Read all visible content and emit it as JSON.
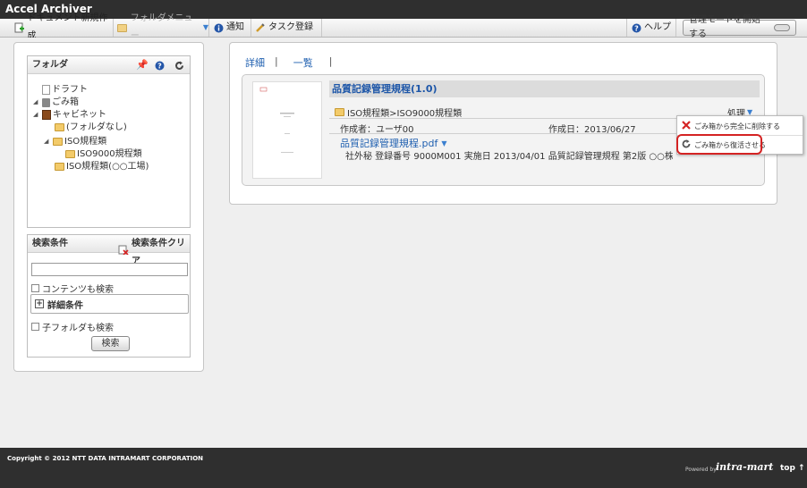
{
  "app": {
    "title": "Accel Archiver"
  },
  "toolbar": {
    "new_doc": "ドキュメント新規作成",
    "folder_menu": "フォルダメニュー",
    "notify": "通知",
    "task": "タスク登録",
    "help": "ヘルプ",
    "admin_mode": "管理モードを開始する"
  },
  "folder_panel": {
    "title": "フォルダ",
    "tree": [
      {
        "label": "ドラフト",
        "icon": "draft-icon"
      },
      {
        "label": "ごみ箱",
        "icon": "trash-icon"
      },
      {
        "label": "キャビネット",
        "icon": "cabinet-icon"
      },
      {
        "label": "(フォルダなし)",
        "icon": "folder-icon"
      },
      {
        "label": "ISO規程類",
        "icon": "folder-icon"
      },
      {
        "label": "ISO9000規程類",
        "icon": "folder-icon"
      },
      {
        "label": "ISO規程類(○○工場)",
        "icon": "folder-icon"
      }
    ]
  },
  "search": {
    "title": "検索条件",
    "clear": "検索条件クリア",
    "input_value": "",
    "content_search": "コンテンツも検索",
    "detail": "詳細条件",
    "subfolder": "子フォルダも検索",
    "button": "検索"
  },
  "main": {
    "tabs": [
      "詳細",
      "一覧"
    ],
    "doc": {
      "title": "品質記録管理規程(1.0)",
      "path": "ISO規程類>ISO9000規程類",
      "action": "処理",
      "author": "作成者：ユーザ00",
      "created": "作成日：2013/06/27",
      "file": "品質記録管理規程.pdf",
      "meta": "社外秘 登録番号 9000M001 実施日 2013/04/01 品質記録管理規程 第2版 ○○株式会社"
    },
    "dropdown": [
      {
        "label": "ごみ箱から完全に削除する",
        "icon": "delete-x-icon"
      },
      {
        "label": "ごみ箱から復活させる",
        "icon": "restore-icon"
      }
    ]
  },
  "footer": {
    "copyright": "Copyright © 2012 NTT DATA INTRAMART CORPORATION",
    "powered": "Powered by",
    "brand": "intra-mart",
    "top": "top ↑"
  }
}
